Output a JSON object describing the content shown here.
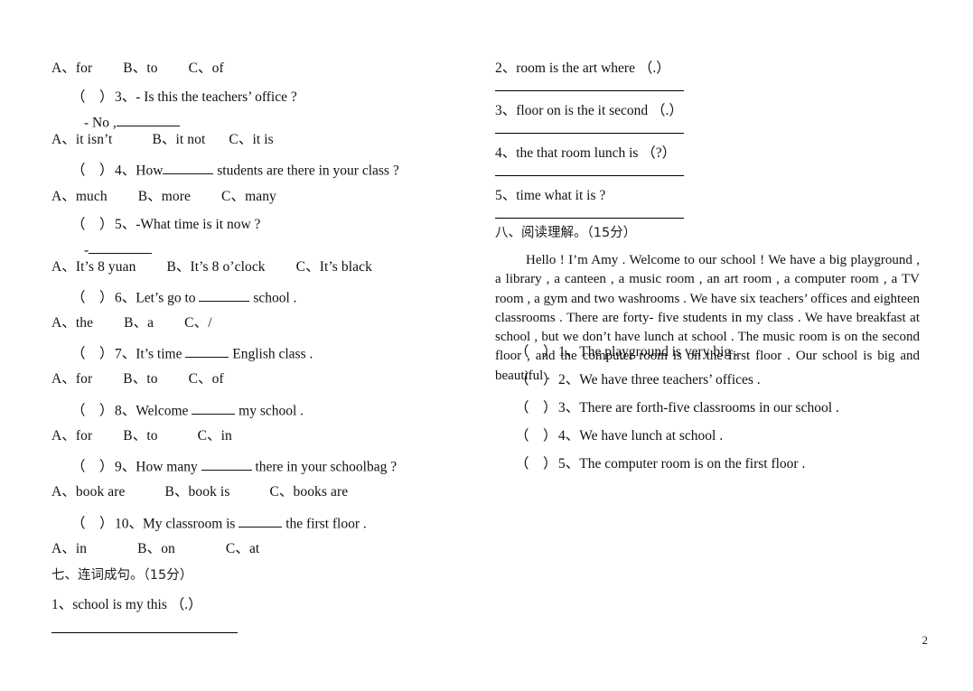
{
  "document": {
    "type": "english-exam-worksheet",
    "page_number": "2"
  },
  "left_column": {
    "options_q2": {
      "a": "A、for",
      "b": "B、to",
      "c": "C、of"
    },
    "q3": {
      "paren": "（　）",
      "text": "3、- Is this the teachers’ office ?",
      "sub": "- No ,",
      "options": {
        "a": "A、it isn’t",
        "b": "B、it not",
        "c": "C、it is"
      }
    },
    "q4": {
      "paren": "（　）",
      "text_before": "4、How",
      "text_after": "students are there in your class ?",
      "options": {
        "a": "A、much",
        "b": "B、more",
        "c": "C、many"
      }
    },
    "q5": {
      "paren": "（　）",
      "text": "5、-What time is it now ?",
      "sub": "-",
      "options": {
        "a": "A、It’s 8 yuan",
        "b": "B、It’s 8 o’clock",
        "c": "C、It’s black"
      }
    },
    "q6": {
      "paren": "（　）",
      "text_before": "6、Let’s go to",
      "text_after": "school .",
      "options": {
        "a": "A、the",
        "b": "B、a",
        "c": "C、/"
      }
    },
    "q7": {
      "paren": "（　）",
      "text_before": "7、It’s time",
      "text_after": "English class .",
      "options": {
        "a": "A、for",
        "b": "B、to",
        "c": "C、of"
      }
    },
    "q8": {
      "paren": "（　）",
      "text_before": "8、Welcome",
      "text_after": "my school .",
      "options": {
        "a": "A、for",
        "b": "B、to",
        "c": "C、in"
      }
    },
    "q9": {
      "paren": "（　）",
      "text_before": "9、How many",
      "text_after": "there in your schoolbag ?",
      "options": {
        "a": "A、book are",
        "b": "B、book is",
        "c": "C、books are"
      }
    },
    "q10": {
      "paren": "（　）",
      "text_before": "10、My classroom is",
      "text_after": "the first floor .",
      "options": {
        "a": "A、in",
        "b": "B、on",
        "c": "C、at"
      }
    },
    "section_seven": {
      "heading": "七、连词成句。（15分）",
      "item_1": "1、school  is   my   this  （.）"
    }
  },
  "right_column": {
    "section_seven_items": [
      "2、room  is  the  art  where  （.）",
      "3、floor  on  is  the  it  second  （.）",
      "4、the  that  room  lunch  is   （?）",
      "5、time  what  it  is ?"
    ],
    "section_eight": {
      "heading": "八、阅读理解。（15分）",
      "passage": "Hello ! I’m Amy . Welcome to our school ! We have a big playground , a library , a canteen , a music room , an art room , a computer room , a TV room , a gym and two washrooms . We have six teachers’ offices and eighteen classrooms . There are forty- five students in my class . We have breakfast at school , but we don’t have lunch at school . The music room is on the second floor , and the computer room is on the first floor . Our school is big and beautiful .",
      "questions": [
        {
          "paren": "（　）",
          "text": "1、The playground is very big ."
        },
        {
          "paren": "（　）",
          "text": "2、We have three teachers’ offices ."
        },
        {
          "paren": "（　）",
          "text": "3、There are forth-five classrooms in our school ."
        },
        {
          "paren": "（　）",
          "text": "4、We have lunch at school ."
        },
        {
          "paren": "（　）",
          "text": "5、The computer room is on the first floor ."
        }
      ]
    }
  }
}
